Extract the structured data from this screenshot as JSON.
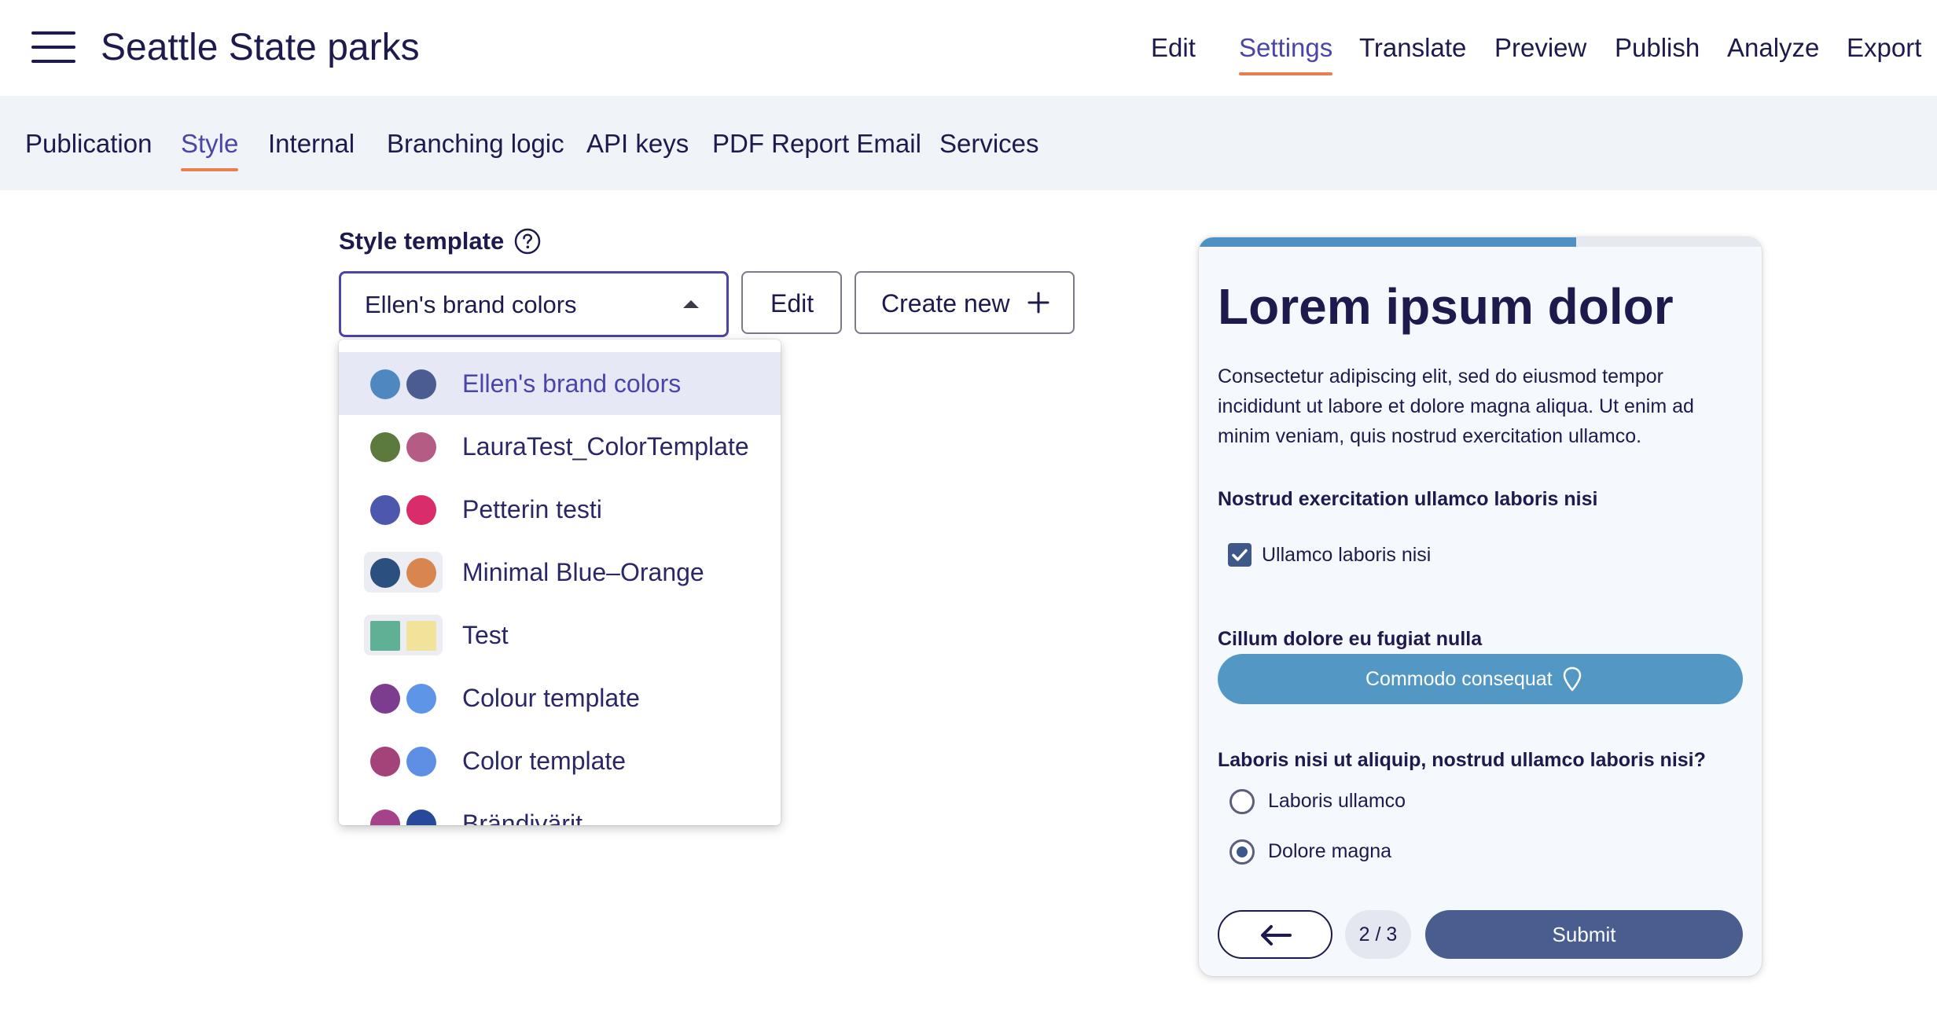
{
  "app": {
    "title": "Seattle State parks"
  },
  "topnav": {
    "items": [
      {
        "label": "Edit"
      },
      {
        "label": "Settings",
        "active": true
      },
      {
        "label": "Translate"
      },
      {
        "label": "Preview"
      },
      {
        "label": "Publish"
      },
      {
        "label": "Analyze"
      },
      {
        "label": "Export"
      }
    ]
  },
  "subnav": {
    "tabs": [
      {
        "label": "Publication"
      },
      {
        "label": "Style",
        "active": true
      },
      {
        "label": "Internal"
      },
      {
        "label": "Branching logic"
      },
      {
        "label": "API keys"
      },
      {
        "label": "PDF Report Email"
      },
      {
        "label": "Services"
      }
    ]
  },
  "style_template": {
    "label": "Style template",
    "selected": "Ellen's brand colors",
    "edit_label": "Edit",
    "create_label": "Create new",
    "options": [
      {
        "label": "Ellen's brand colors",
        "colors": [
          "#4f88c0",
          "#4b5c93"
        ],
        "shape": "circle",
        "selected": true
      },
      {
        "label": "LauraTest_ColorTemplate",
        "colors": [
          "#5c7a3e",
          "#b45c84"
        ],
        "shape": "circle"
      },
      {
        "label": "Petterin testi",
        "colors": [
          "#4d57ad",
          "#d92c6a"
        ],
        "shape": "circle"
      },
      {
        "label": "Minimal Blue–Orange",
        "colors": [
          "#2b4f7e",
          "#d88550"
        ],
        "shape": "circle",
        "framed": true
      },
      {
        "label": "Test",
        "colors": [
          "#60b096",
          "#f1e39a"
        ],
        "shape": "square",
        "framed": true
      },
      {
        "label": "Colour template",
        "colors": [
          "#7d3d8e",
          "#5f95e6"
        ],
        "shape": "circle"
      },
      {
        "label": "Color template",
        "colors": [
          "#a3437a",
          "#5d8fe4"
        ],
        "shape": "circle"
      },
      {
        "label": "Brändivärit",
        "colors": [
          "#a6428a",
          "#27499c"
        ],
        "shape": "circle"
      }
    ]
  },
  "preview": {
    "progress": 0.67,
    "title": "Lorem ipsum dolor",
    "body": "Consectetur adipiscing elit, sed do eiusmod tempor incididunt ut labore et dolore magna aliqua. Ut enim ad minim veniam, quis nostrud exercitation ullamco.",
    "q1": "Nostrud exercitation ullamco laboris nisi",
    "checkbox_label": "Ullamco laboris nisi",
    "checkbox_checked": true,
    "q2": "Cillum dolore eu fugiat nulla",
    "location_button": "Commodo consequat",
    "q3": "Laboris nisi ut aliquip, nostrud ullamco laboris nisi?",
    "radio_options": [
      {
        "label": "Laboris ullamco",
        "selected": false
      },
      {
        "label": "Dolore magna",
        "selected": true
      }
    ],
    "page_indicator": "2 / 3",
    "submit_label": "Submit"
  },
  "colors": {
    "accent": "#4a45a8",
    "underline": "#e8804d",
    "text": "#1d1a4d",
    "primary_button": "#495e8f",
    "location_button": "#5398c4"
  },
  "icons": {
    "menu": "hamburger-icon",
    "help": "question-circle-icon",
    "caret": "caret-up-icon",
    "plus": "plus-icon",
    "pin": "location-pin-icon",
    "back": "arrow-left-icon"
  }
}
